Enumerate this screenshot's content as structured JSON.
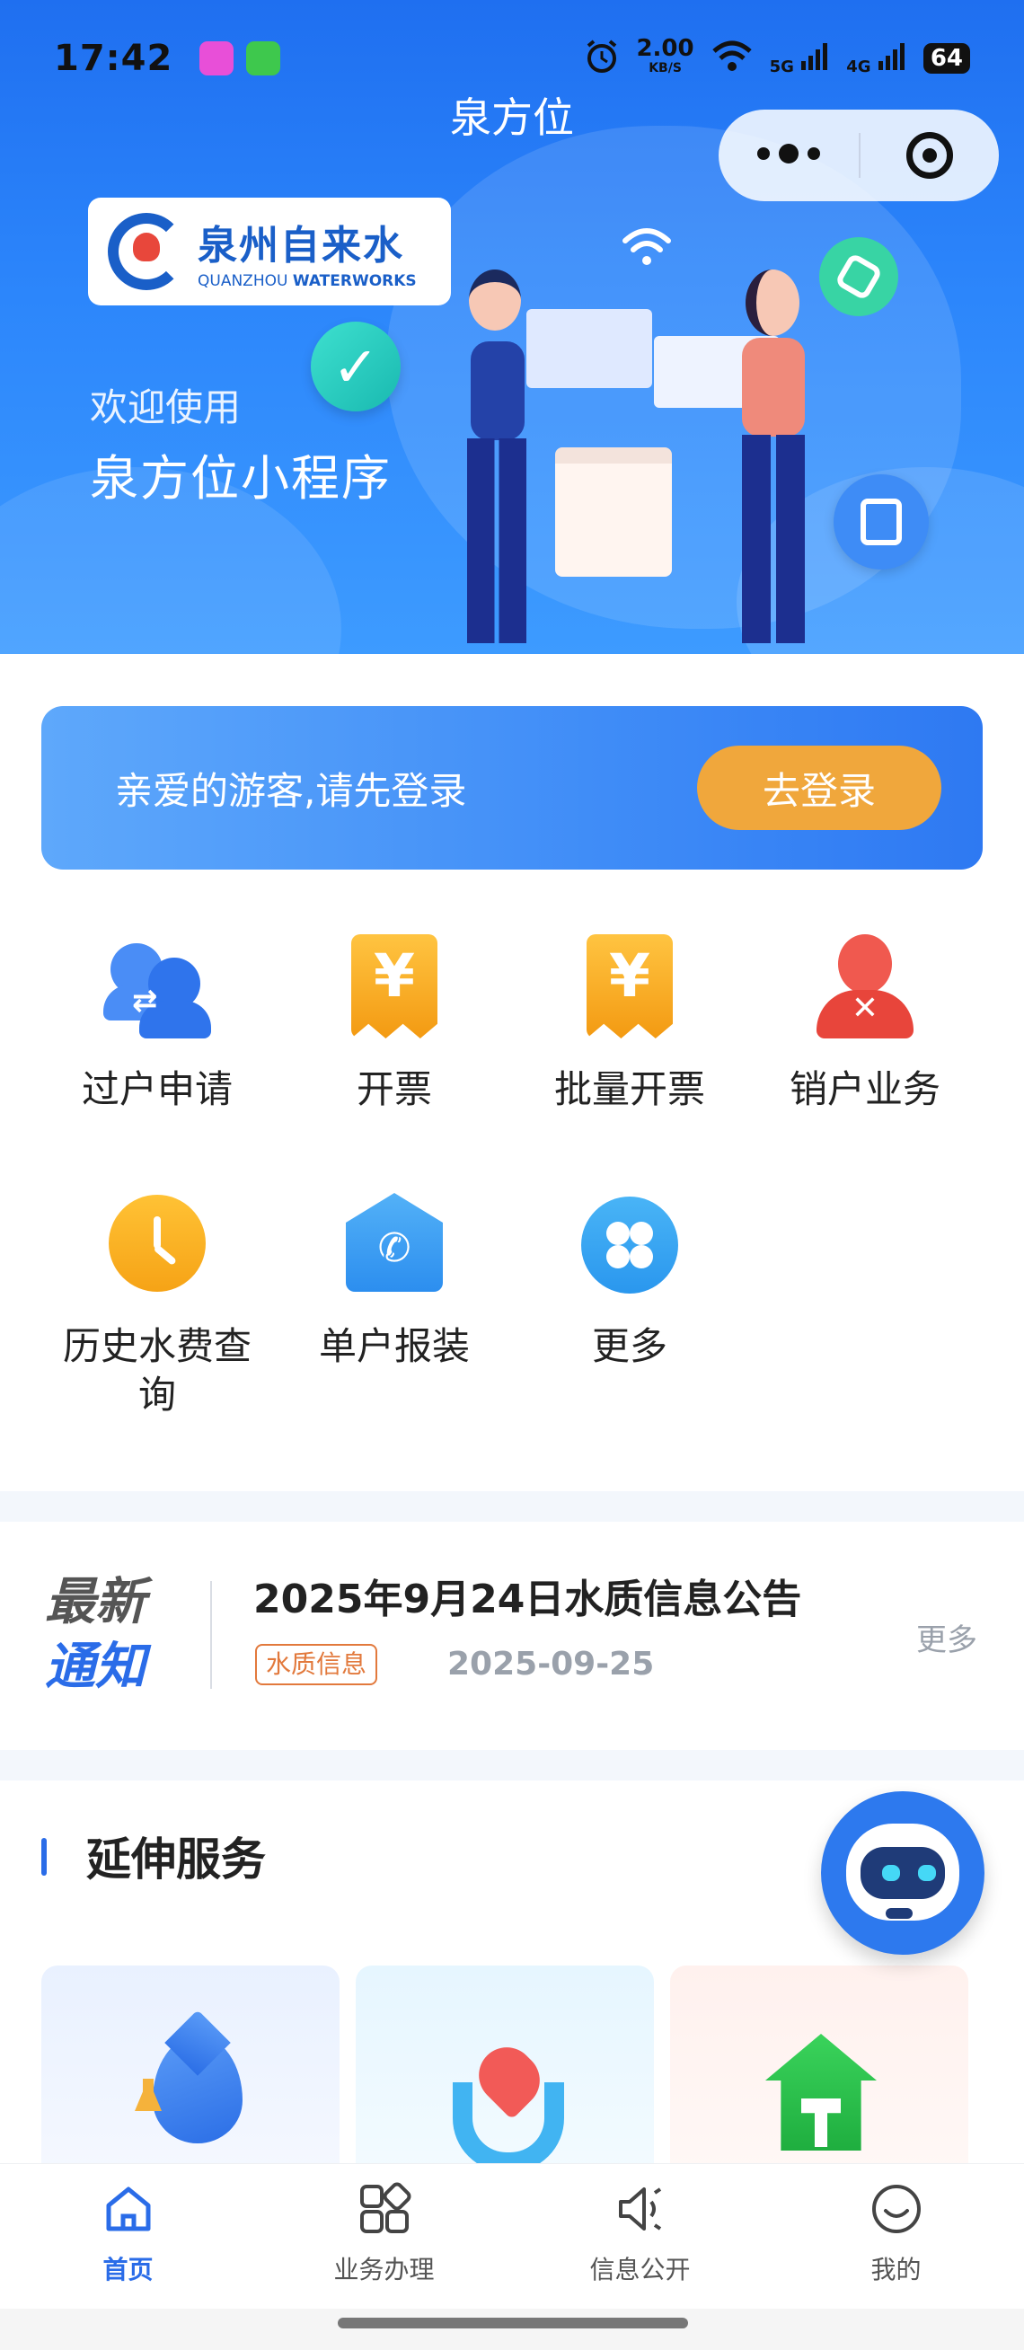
{
  "status_bar": {
    "time": "17:42",
    "speed": "2.00",
    "speed_unit": "KB/S",
    "network1": "5G",
    "network2": "4G",
    "battery": "64"
  },
  "nav": {
    "title": "泉方位"
  },
  "hero": {
    "brand_cn": "泉州自来水",
    "brand_en_prefix": "QUANZHOU ",
    "brand_en_bold": "WATERWORKS",
    "welcome_line1": "欢迎使用",
    "welcome_line2": "泉方位小程序"
  },
  "login": {
    "prompt": "亲爱的游客,请先登录",
    "button": "去登录"
  },
  "services": [
    {
      "label": "过户申请",
      "icon": "transfer-users-icon"
    },
    {
      "label": "开票",
      "icon": "invoice-yen-icon"
    },
    {
      "label": "批量开票",
      "icon": "batch-invoice-yen-icon"
    },
    {
      "label": "销户业务",
      "icon": "cancel-account-icon"
    },
    {
      "label": "历史水费查询",
      "icon": "clock-icon"
    },
    {
      "label": "单户报装",
      "icon": "home-phone-icon"
    },
    {
      "label": "更多",
      "icon": "more-grid-icon"
    }
  ],
  "notice": {
    "label_line1": "最新",
    "label_line2": "通知",
    "title": "2025年9月24日水质信息公告",
    "tag": "水质信息",
    "date": "2025-09-25",
    "more": "更多"
  },
  "extended": {
    "title": "延伸服务"
  },
  "tabs": [
    {
      "label": "首页",
      "icon": "home-icon",
      "active": true
    },
    {
      "label": "业务办理",
      "icon": "apps-icon",
      "active": false
    },
    {
      "label": "信息公开",
      "icon": "speaker-icon",
      "active": false
    },
    {
      "label": "我的",
      "icon": "smile-icon",
      "active": false
    }
  ],
  "colors": {
    "primary": "#2a6ce8",
    "login_button": "#f0a73c",
    "notice_tag": "#e2793c"
  }
}
